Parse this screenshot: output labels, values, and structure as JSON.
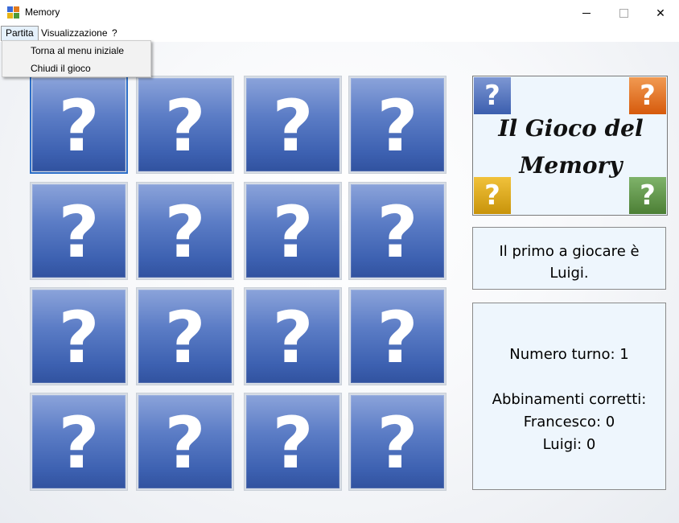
{
  "window": {
    "title": "Memory",
    "controls": {
      "minimize": "minimize-icon",
      "maximize": "maximize-icon",
      "close": "✕"
    }
  },
  "menu": {
    "items": [
      {
        "label": "Partita",
        "active": true
      },
      {
        "label": "Visualizzazione",
        "active": false
      },
      {
        "label": "?",
        "active": false
      }
    ],
    "dropdown": [
      {
        "label": "Torna al menu iniziale"
      },
      {
        "label": "Chiudi il gioco"
      }
    ]
  },
  "board": {
    "rows": 4,
    "cols": 4,
    "card_symbol": "?",
    "selected_card": 0,
    "card_colors": {
      "top": "#8ba3da",
      "bottom": "#31529f"
    }
  },
  "logo": {
    "line1": "Il Gioco del",
    "line2": "Memory",
    "tile_symbol": "?",
    "tile_colors": {
      "blue": "#3b5eae",
      "orange": "#d65a0c",
      "yellow": "#c8930a",
      "green": "#4c7f35"
    }
  },
  "turn_info": {
    "line1": "Il primo a giocare è",
    "line2": "Luigi."
  },
  "stats": {
    "turn_text": "Numero turno: 1",
    "matches_heading": "Abbinamenti corretti:",
    "players": [
      {
        "text": "Francesco: 0"
      },
      {
        "text": "Luigi: 0"
      }
    ]
  }
}
